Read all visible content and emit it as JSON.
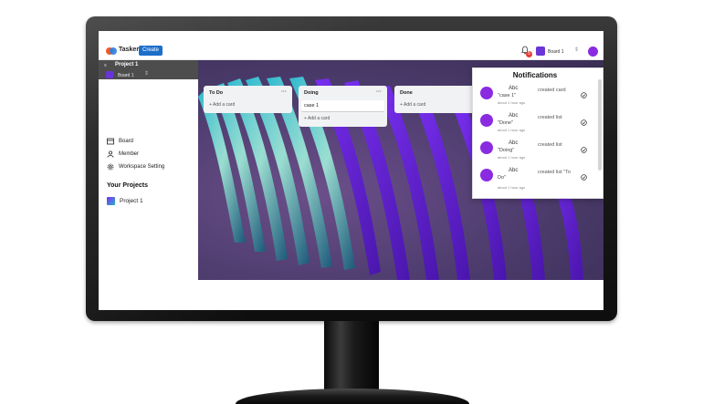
{
  "header": {
    "app_name": "Tasker",
    "create_label": "Create",
    "notification_count": "5",
    "board_selector_label": "Board 1",
    "colors": {
      "create": "#1d6ec9",
      "avatar": "#8a2be2",
      "board": "#6a35d6"
    }
  },
  "sidebar": {
    "project_title": "Project 1",
    "board_label": "Board 1",
    "nav": [
      {
        "label": "Board",
        "icon": "board-icon"
      },
      {
        "label": "Member",
        "icon": "member-icon"
      },
      {
        "label": "Workspace Setting",
        "icon": "gear-icon"
      }
    ],
    "projects_heading": "Your Projects",
    "projects": [
      {
        "label": "Project 1"
      }
    ]
  },
  "lists": [
    {
      "title": "To Do",
      "cards": [],
      "add_label": "Add a card"
    },
    {
      "title": "Doing",
      "cards": [
        "case 1"
      ],
      "add_label": "Add a card"
    },
    {
      "title": "Done",
      "cards": [],
      "add_label": "Add a card"
    }
  ],
  "notifications": {
    "title": "Notifications",
    "items": [
      {
        "user": "Abc",
        "target": "\"case 1\"",
        "action": "created card",
        "time": "about 1 hour ago"
      },
      {
        "user": "Abc",
        "target": "\"Done\"",
        "action": "created list",
        "time": "about 1 hour ago"
      },
      {
        "user": "Abc",
        "target": "\"Doing\"",
        "action": "created list",
        "time": "about 1 hour ago"
      },
      {
        "user": "Abc",
        "target": "Do\"",
        "action": "created list \"To",
        "time": "about 1 hour ago"
      }
    ]
  }
}
